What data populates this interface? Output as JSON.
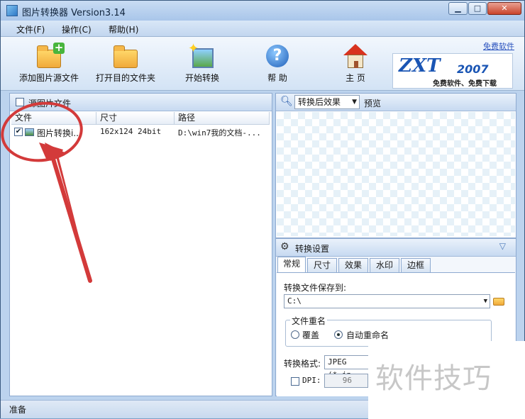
{
  "window": {
    "title": "图片转换器 Version3.14",
    "buttons": [
      "▁",
      "□",
      "✕"
    ]
  },
  "menu": [
    "文件(F)",
    "操作(C)",
    "帮助(H)"
  ],
  "toolbar": {
    "buttons": [
      {
        "label": "添加图片源文件",
        "icon": "add-folder-icon"
      },
      {
        "label": "打开目的文件夹",
        "icon": "folder-icon"
      },
      {
        "label": "开始转换",
        "icon": "magic-wand-icon"
      },
      {
        "label": "帮 助",
        "icon": "help-icon"
      },
      {
        "label": "主 页",
        "icon": "home-icon"
      }
    ],
    "logo": {
      "main": "ZXT",
      "year": "2007",
      "sub": "免费软件、免费下载"
    },
    "link": "免费软件"
  },
  "source_panel": {
    "title": "源图片文件",
    "columns": [
      "文件",
      "尺寸",
      "路径"
    ],
    "rows": [
      {
        "checked": "✔",
        "name": "图片转换i...",
        "size": "162x124  24bit",
        "path": "D:\\win7我的文档-..."
      }
    ]
  },
  "preview_panel": {
    "mode": "转换后效果",
    "label": "预览"
  },
  "settings": {
    "title": "转换设置",
    "tabs": [
      "常规",
      "尺寸",
      "效果",
      "水印",
      "边框"
    ],
    "save_to_label": "转换文件保存到:",
    "save_to_value": "C:\\",
    "rename_group": "文件重名",
    "overwrite": "覆盖",
    "auto_rename": "自动重命名",
    "format_label": "转换格式:",
    "format_value": "JPEG (*.jp",
    "dpi_label": "DPI:",
    "dpi_value": "96"
  },
  "status": "准备",
  "watermark": "软件技巧",
  "colors": {
    "annotation": "#d33a3a",
    "logo": "#1a55b4"
  }
}
